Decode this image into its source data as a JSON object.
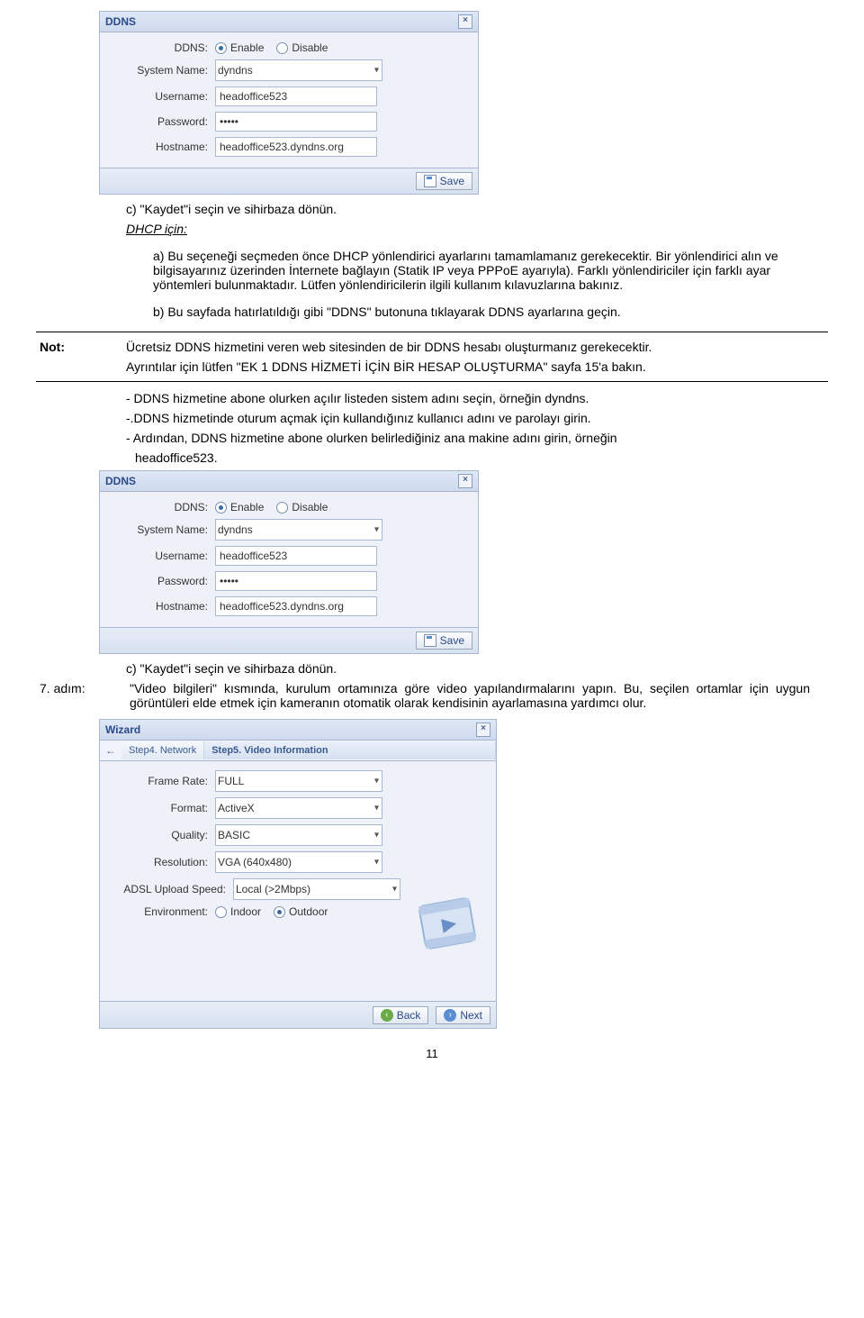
{
  "ddns_panel": {
    "title": "DDNS",
    "close": "×",
    "labels": {
      "ddns": "DDNS:",
      "enable": "Enable",
      "disable": "Disable",
      "system_name": "System Name:",
      "username": "Username:",
      "password": "Password:",
      "hostname": "Hostname:"
    },
    "values": {
      "system_name": "dyndns",
      "username": "headoffice523",
      "password": "•••••",
      "hostname": "headoffice523.dyndns.org"
    },
    "save": "Save"
  },
  "text": {
    "c1": "c)  \"Kaydet\"i seçin ve sihirbaza dönün.",
    "dhcp_head": "DHCP için:",
    "a1": "a)  Bu seçeneği seçmeden önce DHCP yönlendirici ayarlarını tamamlamanız gerekecektir. Bir yönlendirici alın ve bilgisayarınız üzerinden İnternete bağlayın (Statik IP veya PPPoE ayarıyla). Farklı yönlendiriciler için farklı ayar yöntemleri bulunmaktadır. Lütfen yönlendiricilerin ilgili kullanım kılavuzlarına bakınız.",
    "b1": "b)  Bu sayfada hatırlatıldığı gibi \"DDNS\" butonuna tıklayarak DDNS ayarlarına geçin.",
    "note_label": "Not:",
    "note1": "Ücretsiz DDNS hizmetini veren web sitesinden de bir DDNS hesabı oluşturmanız gerekecektir.",
    "note2": "Ayrıntılar için lütfen \"EK 1 DDNS HİZMETİ İÇİN BİR HESAP OLUŞTURMA\" sayfa 15'a bakın.",
    "dash1": "- DDNS hizmetine abone olurken açılır listeden sistem adını seçin, örneğin dyndns.",
    "dash2": "-.DDNS hizmetinde oturum açmak için kullandığınız kullanıcı adını ve parolayı girin.",
    "dash3a": "- Ardından, DDNS hizmetine abone olurken belirlediğiniz ana makine adını girin, örneğin",
    "dash3b": "headoffice523.",
    "c2": "c)  \"Kaydet\"i seçin ve sihirbaza dönün.",
    "step7_label": "7. adım:",
    "step7": "\"Video bilgileri\" kısmında, kurulum ortamınıza göre video yapılandırmalarını yapın. Bu, seçilen ortamlar için uygun görüntüleri elde etmek için kameranın otomatik olarak kendisinin ayarlamasına yardımcı olur."
  },
  "wizard": {
    "title": "Wizard",
    "close": "×",
    "back_arrow": "←",
    "bc_prev": "Step4. Network",
    "bc_cur": "Step5. Video Information",
    "labels": {
      "frame_rate": "Frame Rate:",
      "format": "Format:",
      "quality": "Quality:",
      "resolution": "Resolution:",
      "adsl": "ADSL Upload Speed:",
      "environment": "Environment:",
      "indoor": "Indoor",
      "outdoor": "Outdoor"
    },
    "values": {
      "frame_rate": "FULL",
      "format": "ActiveX",
      "quality": "BASIC",
      "resolution": "VGA (640x480)",
      "adsl": "Local (>2Mbps)"
    },
    "back": "Back",
    "next": "Next"
  },
  "page_number": "11"
}
